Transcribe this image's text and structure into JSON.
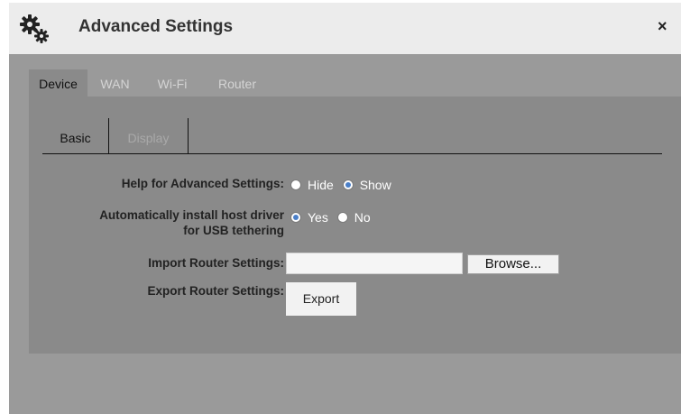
{
  "dialog": {
    "title": "Advanced Settings",
    "icon": "gears-icon",
    "close_glyph": "×"
  },
  "tabs": [
    {
      "label": "Device",
      "active": true
    },
    {
      "label": "WAN",
      "active": false
    },
    {
      "label": "Wi-Fi",
      "active": false
    },
    {
      "label": "Router",
      "active": false
    }
  ],
  "subtabs": [
    {
      "label": "Basic",
      "active": true
    },
    {
      "label": "Display",
      "active": false
    }
  ],
  "settings": {
    "help": {
      "label": "Help for Advanced Settings:",
      "options": [
        "Hide",
        "Show"
      ],
      "selected": "Show"
    },
    "driver": {
      "label_line1": "Automatically install host driver",
      "label_line2": "for USB tethering",
      "options": [
        "Yes",
        "No"
      ],
      "selected": "Yes"
    },
    "import": {
      "label": "Import Router Settings:",
      "value": "",
      "button": "Browse..."
    },
    "export": {
      "label": "Export Router Settings:",
      "button": "Export"
    }
  },
  "colors": {
    "accent_radio": "#4a7fc8",
    "panel": "#8a8a8a",
    "dialog_bg": "#9a9a9a",
    "titlebar": "#ececec"
  }
}
